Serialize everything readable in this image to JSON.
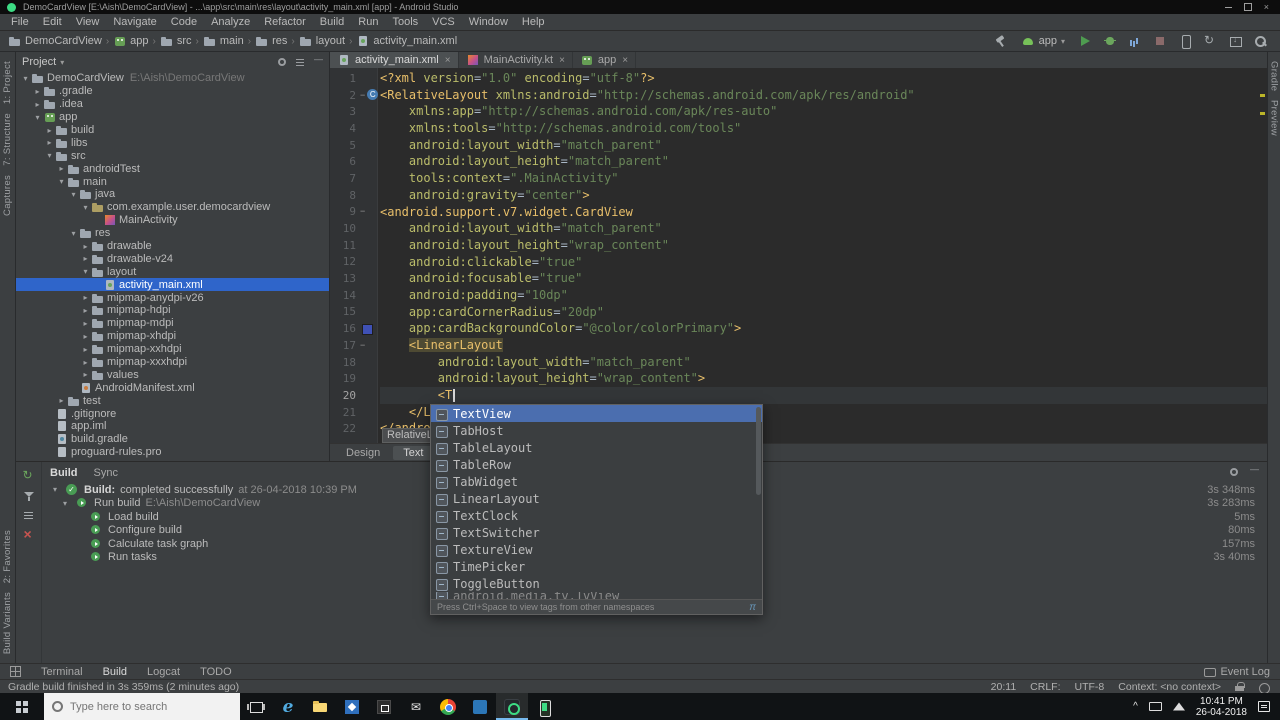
{
  "window": {
    "title": "DemoCardView [E:\\Aish\\DemoCardView] - ...\\app\\src\\main\\res\\layout\\activity_main.xml [app] - Android Studio"
  },
  "menu_bar": {
    "items": [
      "File",
      "Edit",
      "View",
      "Navigate",
      "Code",
      "Analyze",
      "Refactor",
      "Build",
      "Run",
      "Tools",
      "VCS",
      "Window",
      "Help"
    ]
  },
  "toolbar": {
    "breadcrumb": [
      {
        "label": "DemoCardView",
        "icon": "folder"
      },
      {
        "label": "app",
        "icon": "android-module"
      },
      {
        "label": "src",
        "icon": "folder"
      },
      {
        "label": "main",
        "icon": "folder"
      },
      {
        "label": "res",
        "icon": "folder"
      },
      {
        "label": "layout",
        "icon": "folder"
      },
      {
        "label": "activity_main.xml",
        "icon": "android-file"
      }
    ],
    "run_config": "app",
    "actions": [
      "hammer",
      "run-config",
      "run",
      "debug",
      "profiler",
      "stop",
      "avd",
      "sync",
      "sdk",
      "search"
    ]
  },
  "left_stripe": {
    "top": [
      "1: Project",
      "7: Structure",
      "Captures"
    ],
    "bottom": [
      "2: Favorites",
      "Build Variants"
    ]
  },
  "right_stripe": {
    "top": [
      "Gradle",
      "Preview"
    ]
  },
  "project": {
    "title": "Project",
    "tree": [
      {
        "label": "DemoCardView",
        "detail": "E:\\Aish\\DemoCardView",
        "level": 0,
        "icon": "folder",
        "arrow": "down"
      },
      {
        "label": ".gradle",
        "level": 1,
        "icon": "folder",
        "arrow": "right"
      },
      {
        "label": ".idea",
        "level": 1,
        "icon": "folder",
        "arrow": "right"
      },
      {
        "label": "app",
        "level": 1,
        "icon": "android-module",
        "arrow": "down"
      },
      {
        "label": "build",
        "level": 2,
        "icon": "folder",
        "arrow": "right"
      },
      {
        "label": "libs",
        "level": 2,
        "icon": "folder",
        "arrow": "right"
      },
      {
        "label": "src",
        "level": 2,
        "icon": "folder",
        "arrow": "down"
      },
      {
        "label": "androidTest",
        "level": 3,
        "icon": "folder",
        "arrow": "right"
      },
      {
        "label": "main",
        "level": 3,
        "icon": "folder",
        "arrow": "down"
      },
      {
        "label": "java",
        "level": 4,
        "icon": "folder",
        "arrow": "down"
      },
      {
        "label": "com.example.user.democardview",
        "level": 5,
        "icon": "package",
        "arrow": "down"
      },
      {
        "label": "MainActivity",
        "level": 6,
        "icon": "kotlin",
        "arrow": null
      },
      {
        "label": "res",
        "level": 4,
        "icon": "folder",
        "arrow": "down"
      },
      {
        "label": "drawable",
        "level": 5,
        "icon": "folder",
        "arrow": "right"
      },
      {
        "label": "drawable-v24",
        "level": 5,
        "icon": "folder",
        "arrow": "right"
      },
      {
        "label": "layout",
        "level": 5,
        "icon": "folder",
        "arrow": "down"
      },
      {
        "label": "activity_main.xml",
        "level": 6,
        "icon": "android-file",
        "arrow": null,
        "selected": true
      },
      {
        "label": "mipmap-anydpi-v26",
        "level": 5,
        "icon": "folder",
        "arrow": "right"
      },
      {
        "label": "mipmap-hdpi",
        "level": 5,
        "icon": "folder",
        "arrow": "right"
      },
      {
        "label": "mipmap-mdpi",
        "level": 5,
        "icon": "folder",
        "arrow": "right"
      },
      {
        "label": "mipmap-xhdpi",
        "level": 5,
        "icon": "folder",
        "arrow": "right"
      },
      {
        "label": "mipmap-xxhdpi",
        "level": 5,
        "icon": "folder",
        "arrow": "right"
      },
      {
        "label": "mipmap-xxxhdpi",
        "level": 5,
        "icon": "folder",
        "arrow": "right"
      },
      {
        "label": "values",
        "level": 5,
        "icon": "folder",
        "arrow": "right"
      },
      {
        "label": "AndroidManifest.xml",
        "level": 4,
        "icon": "manifest",
        "arrow": null
      },
      {
        "label": "test",
        "level": 3,
        "icon": "folder",
        "arrow": "right"
      },
      {
        "label": ".gitignore",
        "level": 2,
        "icon": "file",
        "arrow": null
      },
      {
        "label": "app.iml",
        "level": 2,
        "icon": "file",
        "arrow": null
      },
      {
        "label": "build.gradle",
        "level": 2,
        "icon": "gradle",
        "arrow": null
      },
      {
        "label": "proguard-rules.pro",
        "level": 2,
        "icon": "file",
        "arrow": null
      }
    ]
  },
  "editor": {
    "tabs": [
      {
        "label": "activity_main.xml",
        "icon": "android-file",
        "active": true
      },
      {
        "label": "MainActivity.kt",
        "icon": "kotlin",
        "active": false
      },
      {
        "label": "app",
        "icon": "android-module",
        "active": false
      }
    ],
    "caret_line": 20,
    "fold_lines": [
      2,
      9,
      17
    ],
    "gutter_icons": {
      "2": "component",
      "16": "color-swatch"
    },
    "tag_hint": "RelativeLayout",
    "lines": [
      {
        "n": 1,
        "t": [
          [
            "tag",
            "<?xml "
          ],
          [
            "attr",
            "version"
          ],
          [
            "op",
            "="
          ],
          [
            "str",
            "\"1.0\""
          ],
          [
            "op",
            " "
          ],
          [
            "attr",
            "encoding"
          ],
          [
            "op",
            "="
          ],
          [
            "str",
            "\"utf-8\""
          ],
          [
            "tag",
            "?>"
          ]
        ]
      },
      {
        "n": 2,
        "t": [
          [
            "tag",
            "<RelativeLayout"
          ],
          [
            "op",
            " "
          ],
          [
            "attr",
            "xmlns:android"
          ],
          [
            "op",
            "="
          ],
          [
            "str",
            "\"http://schemas.android.com/apk/res/android\""
          ]
        ]
      },
      {
        "n": 3,
        "t": [
          [
            "ws",
            "    "
          ],
          [
            "attr",
            "xmlns:app"
          ],
          [
            "op",
            "="
          ],
          [
            "str",
            "\"http://schemas.android.com/apk/res-auto\""
          ]
        ]
      },
      {
        "n": 4,
        "t": [
          [
            "ws",
            "    "
          ],
          [
            "attr",
            "xmlns:tools"
          ],
          [
            "op",
            "="
          ],
          [
            "str",
            "\"http://schemas.android.com/tools\""
          ]
        ]
      },
      {
        "n": 5,
        "t": [
          [
            "ws",
            "    "
          ],
          [
            "attr",
            "android:layout_width"
          ],
          [
            "op",
            "="
          ],
          [
            "str",
            "\"match_parent\""
          ]
        ]
      },
      {
        "n": 6,
        "t": [
          [
            "ws",
            "    "
          ],
          [
            "attr",
            "android:layout_height"
          ],
          [
            "op",
            "="
          ],
          [
            "str",
            "\"match_parent\""
          ]
        ]
      },
      {
        "n": 7,
        "t": [
          [
            "ws",
            "    "
          ],
          [
            "attr",
            "tools:context"
          ],
          [
            "op",
            "="
          ],
          [
            "str",
            "\".MainActivity\""
          ]
        ]
      },
      {
        "n": 8,
        "t": [
          [
            "ws",
            "    "
          ],
          [
            "attr",
            "android:gravity"
          ],
          [
            "op",
            "="
          ],
          [
            "str",
            "\"center\""
          ],
          [
            "tag",
            ">"
          ]
        ]
      },
      {
        "n": 9,
        "t": [
          [
            "tag",
            "<android.support.v7.widget.CardView"
          ]
        ]
      },
      {
        "n": 10,
        "t": [
          [
            "ws",
            "    "
          ],
          [
            "attr",
            "android:layout_width"
          ],
          [
            "op",
            "="
          ],
          [
            "str",
            "\"match_parent\""
          ]
        ]
      },
      {
        "n": 11,
        "t": [
          [
            "ws",
            "    "
          ],
          [
            "attr",
            "android:layout_height"
          ],
          [
            "op",
            "="
          ],
          [
            "str",
            "\"wrap_content\""
          ]
        ]
      },
      {
        "n": 12,
        "t": [
          [
            "ws",
            "    "
          ],
          [
            "attr",
            "android:clickable"
          ],
          [
            "op",
            "="
          ],
          [
            "str",
            "\"true\""
          ]
        ]
      },
      {
        "n": 13,
        "t": [
          [
            "ws",
            "    "
          ],
          [
            "attr",
            "android:focusable"
          ],
          [
            "op",
            "="
          ],
          [
            "str",
            "\"true\""
          ]
        ]
      },
      {
        "n": 14,
        "t": [
          [
            "ws",
            "    "
          ],
          [
            "attr",
            "android:padding"
          ],
          [
            "op",
            "="
          ],
          [
            "str",
            "\"10dp\""
          ]
        ]
      },
      {
        "n": 15,
        "t": [
          [
            "ws",
            "    "
          ],
          [
            "attr",
            "app:cardCornerRadius"
          ],
          [
            "op",
            "="
          ],
          [
            "str",
            "\"20dp\""
          ]
        ]
      },
      {
        "n": 16,
        "t": [
          [
            "ws",
            "    "
          ],
          [
            "attr",
            "app:cardBackgroundColor"
          ],
          [
            "op",
            "="
          ],
          [
            "str",
            "\"@color/colorPrimary\""
          ],
          [
            "tag",
            ">"
          ]
        ]
      },
      {
        "n": 17,
        "t": [
          [
            "ws",
            "    "
          ],
          [
            "taghl",
            "<LinearLayout"
          ]
        ]
      },
      {
        "n": 18,
        "t": [
          [
            "ws",
            "        "
          ],
          [
            "attr",
            "android:layout_width"
          ],
          [
            "op",
            "="
          ],
          [
            "str",
            "\"match_parent\""
          ]
        ]
      },
      {
        "n": 19,
        "t": [
          [
            "ws",
            "        "
          ],
          [
            "attr",
            "android:layout_height"
          ],
          [
            "op",
            "="
          ],
          [
            "str",
            "\"wrap_content\""
          ],
          [
            "tag",
            ">"
          ]
        ]
      },
      {
        "n": 20,
        "t": [
          [
            "ws",
            "        "
          ],
          [
            "tag",
            "<T"
          ],
          [
            "caret",
            ""
          ]
        ]
      },
      {
        "n": 21,
        "t": [
          [
            "ws",
            "    "
          ],
          [
            "tag",
            "</L"
          ]
        ]
      },
      {
        "n": 22,
        "t": [
          [
            "tag",
            "</andro"
          ]
        ]
      }
    ]
  },
  "completion": {
    "items": [
      {
        "label": "TextView",
        "selected": true
      },
      {
        "label": "TabHost"
      },
      {
        "label": "TableLayout"
      },
      {
        "label": "TableRow"
      },
      {
        "label": "TabWidget"
      },
      {
        "label": "LinearLayout"
      },
      {
        "label": "TextClock"
      },
      {
        "label": "TextSwitcher"
      },
      {
        "label": "TextureView"
      },
      {
        "label": "TimePicker"
      },
      {
        "label": "ToggleButton"
      },
      {
        "label": "android.media.tv.TvView",
        "clipped": true
      }
    ],
    "hint": "Press Ctrl+Space to view tags from other namespaces",
    "sort_symbol": "π"
  },
  "editor_mode_tabs": [
    {
      "label": "Design",
      "active": false
    },
    {
      "label": "Text",
      "active": true
    }
  ],
  "build_panel": {
    "tabs": [
      {
        "label": "Build",
        "active": true
      },
      {
        "label": "Sync",
        "active": false
      }
    ],
    "header": {
      "label": "Build:",
      "message": "completed successfully",
      "timestamp": "at 26-04-2018 10:39 PM",
      "duration": "3s 348ms"
    },
    "rows": [
      {
        "label": "Run build",
        "detail": "E:\\Aish\\DemoCardView",
        "duration": "3s 283ms",
        "level": 0,
        "arrow": true
      },
      {
        "label": "Load build",
        "duration": "5ms",
        "level": 1
      },
      {
        "label": "Configure build",
        "duration": "80ms",
        "level": 1
      },
      {
        "label": "Calculate task graph",
        "duration": "157ms",
        "level": 1
      },
      {
        "label": "Run tasks",
        "duration": "3s 40ms",
        "level": 1
      }
    ]
  },
  "tool_window_bar": {
    "items": [
      {
        "label": "Terminal"
      },
      {
        "label": "Build",
        "active": true
      },
      {
        "label": "Logcat"
      },
      {
        "label": "TODO"
      }
    ],
    "event_log": "Event Log"
  },
  "status_bar": {
    "message": "Gradle build finished in 3s 359ms (2 minutes ago)",
    "caret_position": "20:11",
    "line_ending": "CRLF:",
    "encoding": "UTF-8",
    "context": "Context: <no context>"
  },
  "taskbar": {
    "search_placeholder": "Type here to search",
    "apps": [
      {
        "name": "task-view"
      },
      {
        "name": "edge"
      },
      {
        "name": "file-explorer"
      },
      {
        "name": "photos"
      },
      {
        "name": "store"
      },
      {
        "name": "mail"
      },
      {
        "name": "chrome"
      },
      {
        "name": "vs-code"
      },
      {
        "name": "android-studio",
        "active": true
      },
      {
        "name": "emulator"
      }
    ],
    "clock_time": "10:41 PM",
    "clock_date": "26-04-2018"
  },
  "colors": {
    "selection_blue": "#2F65CA",
    "popup_selection": "#4B6EAF",
    "xml_tag": "#E8BF6A",
    "xml_attribute": "#BABC6A",
    "xml_string": "#6A8759",
    "build_success_green": "#499C54",
    "color_primary_swatch": "#3F51B5",
    "taskbar_accent": "#76B9ED"
  }
}
